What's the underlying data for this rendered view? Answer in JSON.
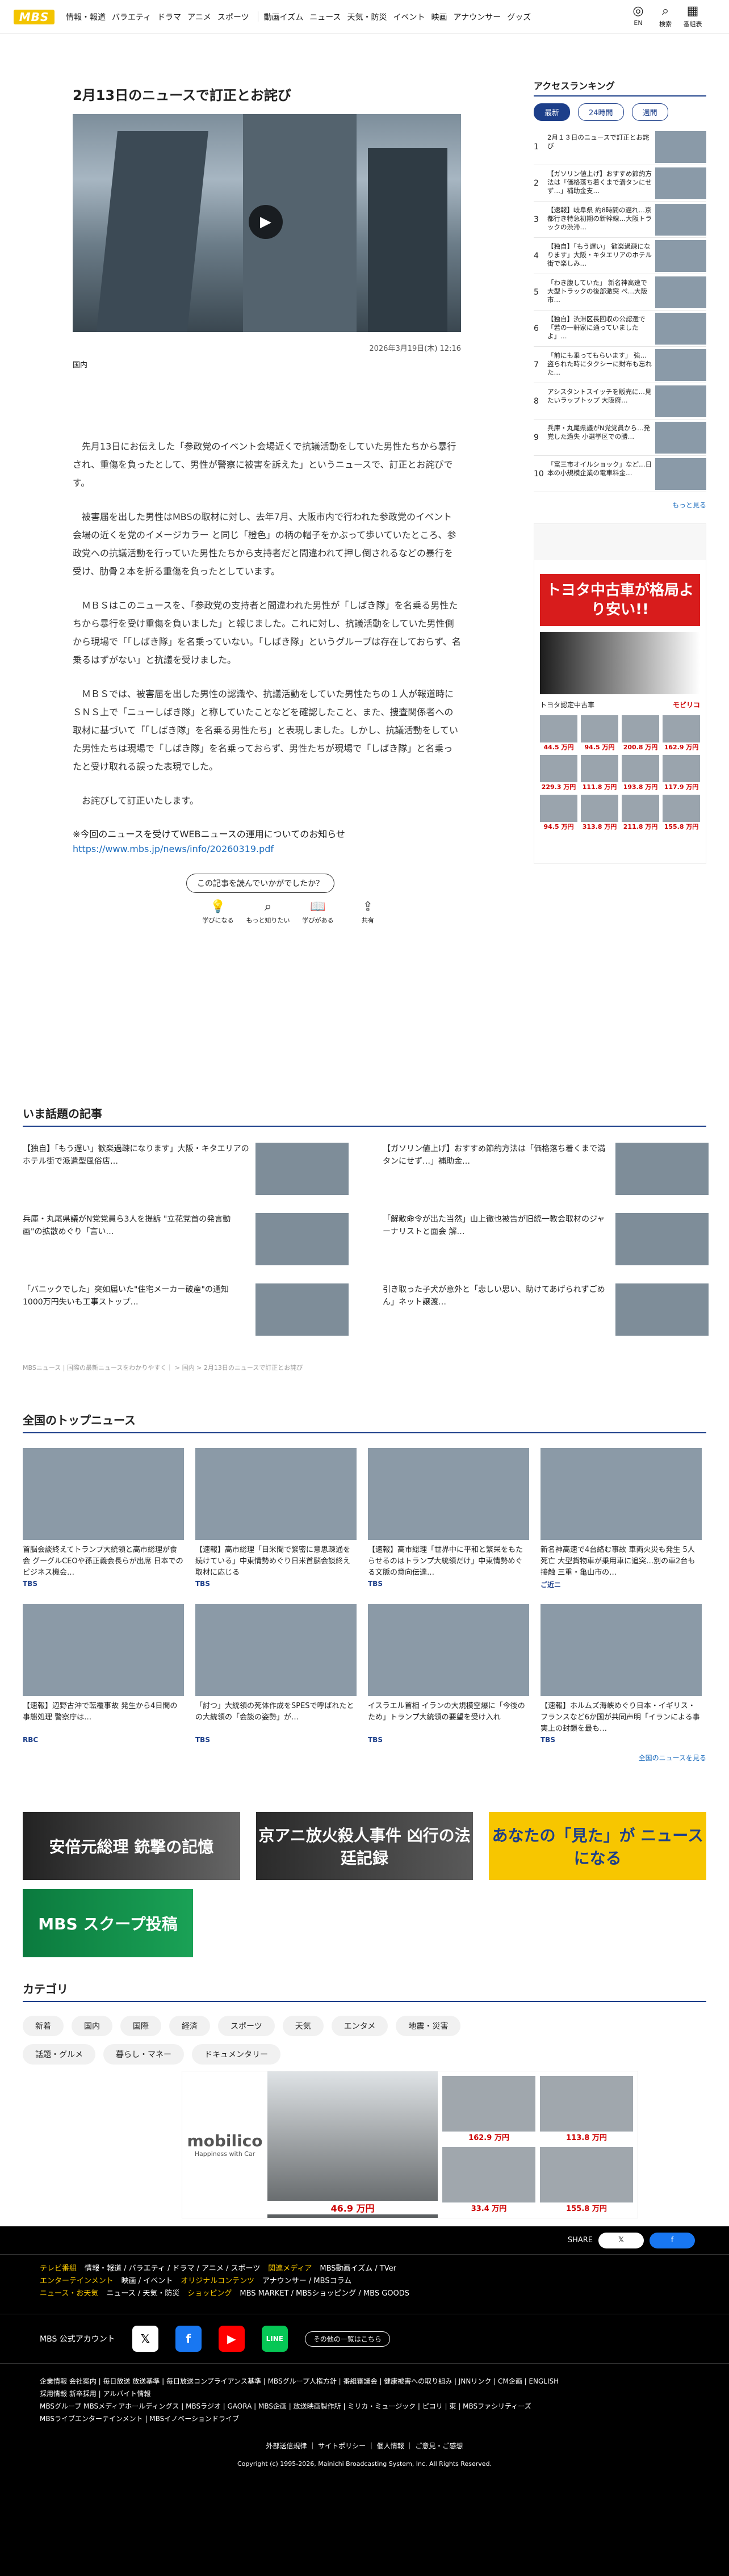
{
  "header": {
    "logo": "MBS",
    "nav1": [
      "情報・報道",
      "バラエティ",
      "ドラマ",
      "アニメ",
      "スポーツ"
    ],
    "nav2": [
      "動画イズム",
      "ニュース",
      "天気・防災",
      "イベント",
      "映画",
      "アナウンサー",
      "グッズ"
    ],
    "icons": [
      {
        "label": "EN",
        "icon": "globe-icon"
      },
      {
        "label": "検索",
        "icon": "search-icon"
      },
      {
        "label": "番組表",
        "icon": "grid-icon"
      }
    ]
  },
  "article": {
    "title": "2月13日のニュースで訂正とお詫び",
    "date": "2026年3月19日(木) 12:16",
    "category": "国内",
    "paragraphs": [
      "先月13日にお伝えした「参政党のイベント会場近くで抗議活動をしていた男性たちから暴行され、重傷を負ったとして、男性が警察に被害を訴えた」というニュースで、訂正とお詫びです。",
      "被害届を出した男性はMBSの取材に対し、去年7月、大阪市内で行われた参政党のイベント会場の近くを党のイメージカラー と同じ「橙色」の柄の帽子をかぶって歩いていたところ、参政党への抗議活動を行っていた男性たちから支持者だと間違われて押し倒されるなどの暴行を受け、肋骨２本を折る重傷を負ったとしています。",
      "ＭＢＳはこのニュースを、「参政党の支持者と間違われた男性が「しばき隊」を名乗る男性たちから暴行を受け重傷を負いました」と報じました。これに対し、抗議活動をしていた男性側から現場で「「しばき隊」を名乗っていない。「しばき隊」というグループは存在しておらず、名乗るはずがない」と抗議を受けました。",
      "ＭＢＳでは、被害届を出した男性の認識や、抗議活動をしていた男性たちの１人が報道時にＳＮＳ上で「ニューしばき隊」と称していたことなどを確認したこと、また、捜査関係者への取材に基づいて「「しばき隊」を名乗る男性たち」と表現しました。しかし、抗議活動をしていた男性たちは現場で「しばき隊」を名乗っておらず、男性たちが現場で「しばき隊」と名乗ったと受け取れる誤った表現でした。",
      "お詫びして訂正いたします。"
    ],
    "note": "※今回のニュースを受けてWEBニュースの運用についてのお知らせ",
    "note_link": "https://www.mbs.jp/news/info/20260319.pdf",
    "feedback_question": "この記事を読んでいかがでしたか？",
    "reactions": [
      {
        "label": "学びになる",
        "icon": "bulb-icon"
      },
      {
        "label": "もっと知りたい",
        "icon": "search-icon"
      },
      {
        "label": "学びがある",
        "icon": "book-icon"
      },
      {
        "label": "共有",
        "icon": "share-icon"
      }
    ]
  },
  "sidebar": {
    "title": "アクセスランキング",
    "tabs": [
      "最新",
      "24時間",
      "週間"
    ],
    "ranking": [
      "2月１３日のニュースで訂正とお詫び",
      "【ガソリン値上げ】おすすめ節約方法は「価格落ち着くまで満タンにせず…」補助金支…",
      "【速報】岐阜県 約8時間の遅れ…京都行き特急初期の新幹線…大阪トラックの渋滞…",
      "【独自】「もう遅い」 歓楽過疎になります」大阪・キタエリアのホテル街で楽しみ…",
      "「わき腹していた」 新名神高速で大型トラックの後部激突 ペ…大阪市…",
      "【独自】渋滞区長回収の公認選で「若の一軒家に通っていましたよ」…",
      "「前にも乗ってもらいます」 強…盗られた時にタクシーに財布も忘れた…",
      "アシスタントスイッチを販売に…見たいラップトップ 大阪府…",
      "兵庫・丸尾県議がN党党員から…発覚した過失 小選挙区での勝…",
      "「富三市オイルショック」など…日本の小規模企業の電車料金…"
    ],
    "more": "もっと見る",
    "ad": {
      "headline": "トヨタ中古車が格局より安い!!",
      "brand": "トヨタ認定中古車",
      "shop": "モビリコ",
      "prices": [
        "44.5 万円",
        "94.5 万円",
        "200.8 万円",
        "162.9 万円",
        "229.3 万円",
        "111.8 万円",
        "193.8 万円",
        "117.9 万円",
        "94.5 万円",
        "313.8 万円",
        "211.8 万円",
        "155.8 万円"
      ]
    }
  },
  "hot": {
    "title": "いま話題の記事",
    "items": [
      "【独自】「もう遅い」歓楽過疎になります」大阪・キタエリアのホテル街で派遣型風俗店…",
      "【ガソリン値上げ】おすすめ節約方法は「価格落ち着くまで満タンにせず…」補助金…",
      "兵庫・丸尾県議がN党党員ら3人を提訴 \"立花党首の発言動画\"の拡散めぐり「言い…",
      "「解散命令が出た当然」山上徹也被告が旧統一教会取材のジャーナリストと面会 解…",
      "「バニックでした」突如届いた\"住宅メーカー破産\"の通知 1000万円失いも工事ストップ…",
      "引き取った子犬が意外と「悲しい思い、助けてあげられずごめん」ネット譲渡…"
    ],
    "breadcrumb": "MBSニュース | 国際の最新ニュースをわかりやすく｜ > 国内 > 2月13日のニュースで訂正とお詫び"
  },
  "top": {
    "title": "全国のトップニュース",
    "items": [
      {
        "text": "首脳会談終えてトランプ大統領と高市総理が食会 グーグルCEOや孫正義会長らが出席 日本でのビジネス機会…",
        "src": "TBS"
      },
      {
        "text": "【速報】高市総理「日米間で緊密に意思疎通を続けている」中東情勢めぐり日米首脳会談終え取材に応じる",
        "src": "TBS"
      },
      {
        "text": "【速報】高市総理「世界中に平和と繁栄をもたらせるのはトランプ大統領だけ」中東情勢めぐる文脈の意向伝達…",
        "src": "TBS"
      },
      {
        "text": "新名神高速で4台絡む事故 車両火災も発生 5人死亡 大型貨物車が乗用車に追突…別の車2台も接触 三重・亀山市の…",
        "src": "ご近ニ"
      },
      {
        "text": "【速報】辺野古沖で転覆事故 発生から4日間の事態処理 警察庁は…",
        "src": "RBC"
      },
      {
        "text": "「討つ」大統領の死体作成をSPESで呼ばれたとの大統領の「会談の姿勢」が…",
        "src": "TBS"
      },
      {
        "text": "イスラエル首相 イランの大規模空爆に「今後のため」トランプ大統領の要望を受け入れ",
        "src": "TBS"
      },
      {
        "text": "【速報】ホルムズ海峡めぐり日本・イギリス・フランスなど6か国が共同声明「イランによる事実上の封鎖を最も…",
        "src": "TBS"
      }
    ],
    "more": "全国のニュースを見る"
  },
  "banners": [
    {
      "text": "安倍元総理 銃撃の記憶"
    },
    {
      "text": "京アニ放火殺人事件 凶行の法廷記録"
    },
    {
      "text": "あなたの「見た」が ニュースになる"
    }
  ],
  "scoop": "MBS スクープ投稿",
  "categories": {
    "title": "カテゴリ",
    "items": [
      "新着",
      "国内",
      "国際",
      "経済",
      "スポーツ",
      "天気",
      "エンタメ",
      "地震・災害",
      "話題・グルメ",
      "暮らし・マネー",
      "ドキュメンタリー"
    ]
  },
  "ad2": {
    "brand": "mobilico",
    "tagline": "Happiness with Car",
    "prices": [
      "46.9 万円",
      "162.9 万円",
      "113.8 万円",
      "33.4 万円",
      "155.8 万円"
    ]
  },
  "footer": {
    "share": "SHARE",
    "rows": [
      [
        "テレビ番組",
        "情報・報道 / バラエティ / ドラマ / アニメ / スポーツ",
        "関連メディア",
        "MBS動画イズム / TVer"
      ],
      [
        "エンターテインメント",
        "映画 / イベント",
        "オリジナルコンテンツ",
        "アナウンサー / MBSコラム"
      ],
      [
        "ニュース・お天気",
        "ニュース / 天気・防災",
        "ショッピング",
        "MBS MARKET / MBSショッピング / MBS GOODS"
      ]
    ],
    "official": "MBS 公式アカウント",
    "more_official": "その他の一覧はこちら",
    "links": "企業情報 会社案内 | 毎日放送 放送基準 | 毎日放送コンプライアンス基準 | MBSグループ人権方針 | 番組審議会 | 健康被害への取り組み | JNNリンク | CM企画 | ENGLISH",
    "links2": "採用情報 新卒採用 | アルバイト情報",
    "links3": "MBSグループ MBSメディアホールディングス | MBSラジオ | GAORA | MBS企画 | 放送映画製作所 | ミリカ・ミュージック | ピコリ | 東 | MBSファシリティーズ",
    "links4": "MBSライブエンターテインメント | MBSイノベーションドライブ",
    "center": "外部送信規律 ｜ サイトポリシー ｜ 個人情報 ｜ ご意見・ご感想",
    "copyright": "Copyright (c) 1995-2026, Mainichi Broadcasting System, Inc. All Rights Reserved."
  }
}
